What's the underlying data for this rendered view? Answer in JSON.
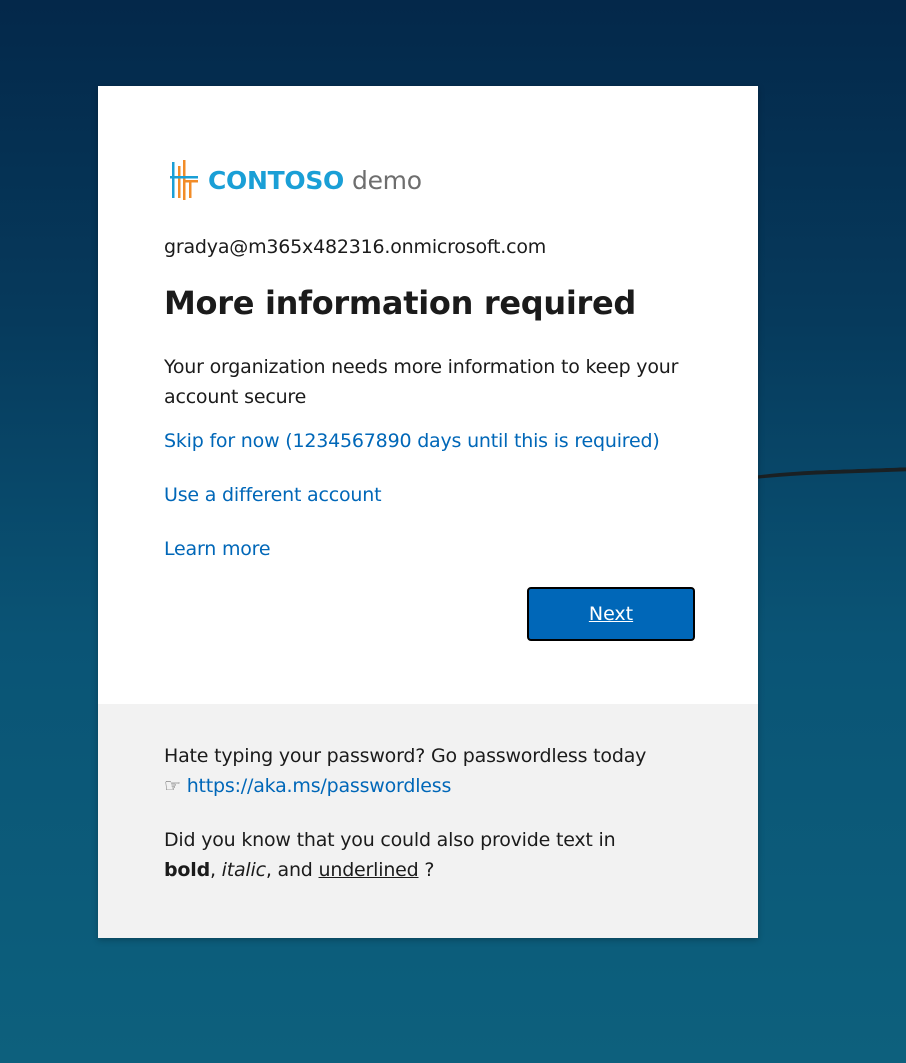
{
  "brand": {
    "name": "CONTOSO",
    "suffix": "demo",
    "colors": {
      "blue": "#1a9fd6",
      "orange": "#f28c28",
      "gray": "#6e6e6e"
    }
  },
  "account": {
    "email": "gradya@m365x482316.onmicrosoft.com"
  },
  "main": {
    "title": "More information required",
    "description": "Your organization needs more information to keep your account secure",
    "skip_link": "Skip for now (1234567890 days until this is required)",
    "different_account_link": "Use a different account",
    "learn_more_link": "Learn more",
    "next_button": "Next"
  },
  "footer": {
    "line1": "Hate typing your password? Go passwordless today",
    "pointer_icon": "pointing-hand-icon",
    "link": "https://aka.ms/passwordless",
    "line2_prefix": "Did you know that you could also provide text in",
    "bold_word": "bold",
    "comma1": ",",
    "italic_word": "italic",
    "and_text": ", and",
    "underlined_word": "underlined",
    "suffix": "?"
  },
  "colors": {
    "accent": "#0067b8",
    "footer_bg": "#f2f2f2",
    "text": "#1b1b1b"
  }
}
